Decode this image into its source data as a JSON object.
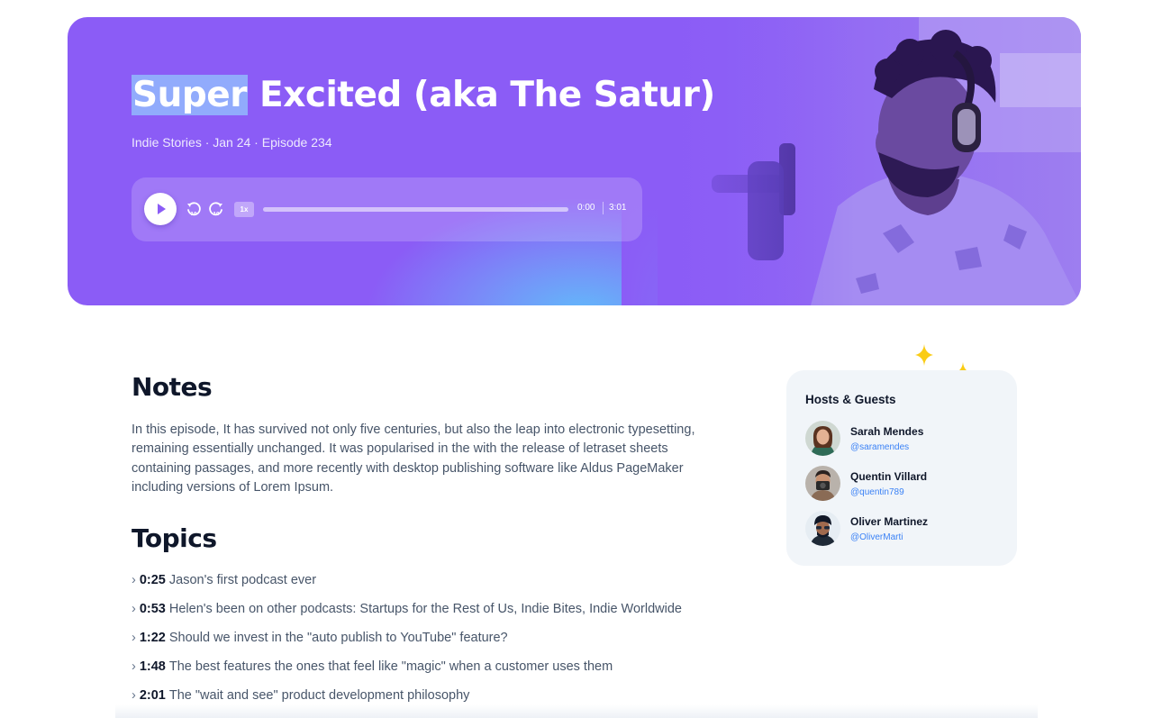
{
  "episode": {
    "title_highlight": "Super",
    "title_rest": " Excited (aka The Satur)",
    "meta": "Indie Stories · Jan 24 · Episode 234"
  },
  "player": {
    "play_icon": "play-icon",
    "rewind_icon": "rewind-10-icon",
    "forward_icon": "forward-10-icon",
    "speed": "1x",
    "current_time": "0:00",
    "duration": "3:01",
    "progress": 0
  },
  "notes": {
    "title": "Notes",
    "text": "In this episode, It has survived not only five centuries, but also the leap into electronic typesetting, remaining essentially unchanged. It was popularised in the with the release of letraset sheets containing passages, and more recently with desktop publishing software like Aldus PageMaker including versions of Lorem Ipsum."
  },
  "topics": {
    "title": "Topics",
    "items": [
      {
        "time": "0:25",
        "text": "Jason's first podcast ever"
      },
      {
        "time": "0:53",
        "text": "Helen's been on other podcasts: Startups for the Rest of Us, Indie Bites, Indie Worldwide"
      },
      {
        "time": "1:22",
        "text": "Should we invest in the \"auto publish to YouTube\" feature?"
      },
      {
        "time": "1:48",
        "text": "The best features the ones that feel like \"magic\" when a customer uses them"
      },
      {
        "time": "2:01",
        "text": "The \"wait and see\" product development philosophy"
      }
    ]
  },
  "hosts": {
    "title": "Hosts & Guests",
    "people": [
      {
        "name": "Sarah Mendes",
        "handle": "@saramendes"
      },
      {
        "name": "Quentin Villard",
        "handle": "@quentin789"
      },
      {
        "name": "Oliver Martinez",
        "handle": "@OliverMarti"
      }
    ]
  },
  "colors": {
    "accent": "#8b5cf6",
    "link": "#3b82f6",
    "sparkle": "#facc15"
  }
}
